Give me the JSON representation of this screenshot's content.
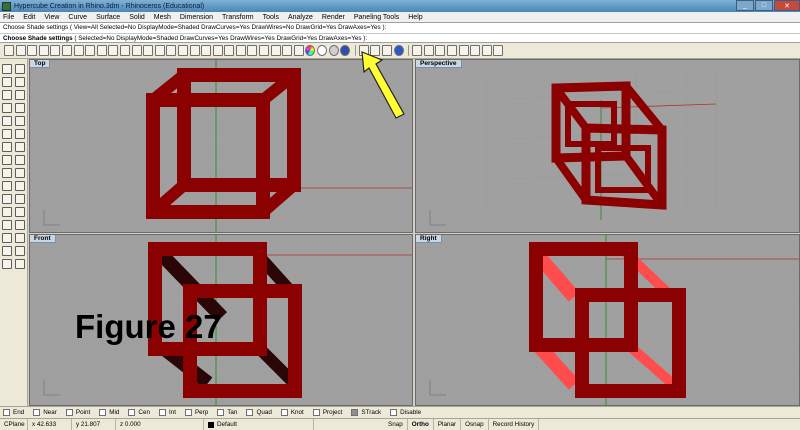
{
  "window": {
    "title": "Hypercube Creation in Rhino.3dm - Rhinoceros (Educational)",
    "controls": [
      "_",
      "□",
      "✕"
    ]
  },
  "menu": [
    "File",
    "Edit",
    "View",
    "Curve",
    "Surface",
    "Solid",
    "Mesh",
    "Dimension",
    "Transform",
    "Tools",
    "Analyze",
    "Render",
    "Paneling Tools",
    "Help"
  ],
  "command": {
    "history": "Choose Shade settings ( View=All  Selected=No  DisplayMode=Shaded  DrawCurves=Yes  DrawWires=No  DrawGrid=Yes  DrawAxes=Yes ):",
    "prompt": "Choose Shade settings",
    "prompt_rest": " ( Selected=No  DisplayMode=Shaded  DrawCurves=Yes  DrawWires=Yes  DrawGrid=Yes  DrawAxes=Yes ):"
  },
  "viewports": {
    "top": "Top",
    "perspective": "Perspective",
    "front": "Front",
    "right": "Right"
  },
  "figure_label": "Figure 27",
  "osnap": [
    "End",
    "Near",
    "Point",
    "Mid",
    "Cen",
    "Int",
    "Perp",
    "Tan",
    "Quad",
    "Knot",
    "Project",
    "STrack",
    "Disable"
  ],
  "status": {
    "cplane": "CPlane",
    "x": "x 42.633",
    "y": "y 21.807",
    "z": "z 0.000",
    "layer": "Default",
    "snap": "Snap",
    "ortho": "Ortho",
    "planar": "Planar",
    "osnap": "Osnap",
    "record": "Record History"
  },
  "colors": {
    "object": "#8b0000",
    "highlight": "#ff4d4d",
    "viewport_bg": "#a0a0a0",
    "arrow": "#ffff33"
  }
}
